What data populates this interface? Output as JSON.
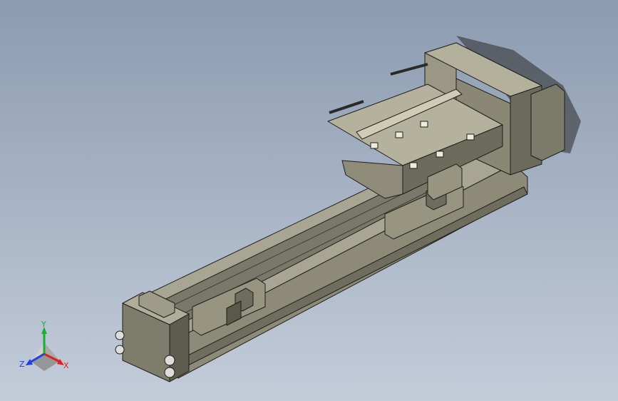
{
  "viewport": {
    "background_top": "#8c9bb1",
    "background_bottom": "#c3ccd9",
    "model_fill_light": "#a8a592",
    "model_fill_mid": "#8d8b78",
    "model_fill_dark": "#5e5c4f",
    "model_edge": "#1e1e1a"
  },
  "triad": {
    "x_label": "X",
    "y_label": "Y",
    "z_label": "Z",
    "x_color": "#e02020",
    "y_color": "#18b030",
    "z_color": "#2040e0"
  }
}
